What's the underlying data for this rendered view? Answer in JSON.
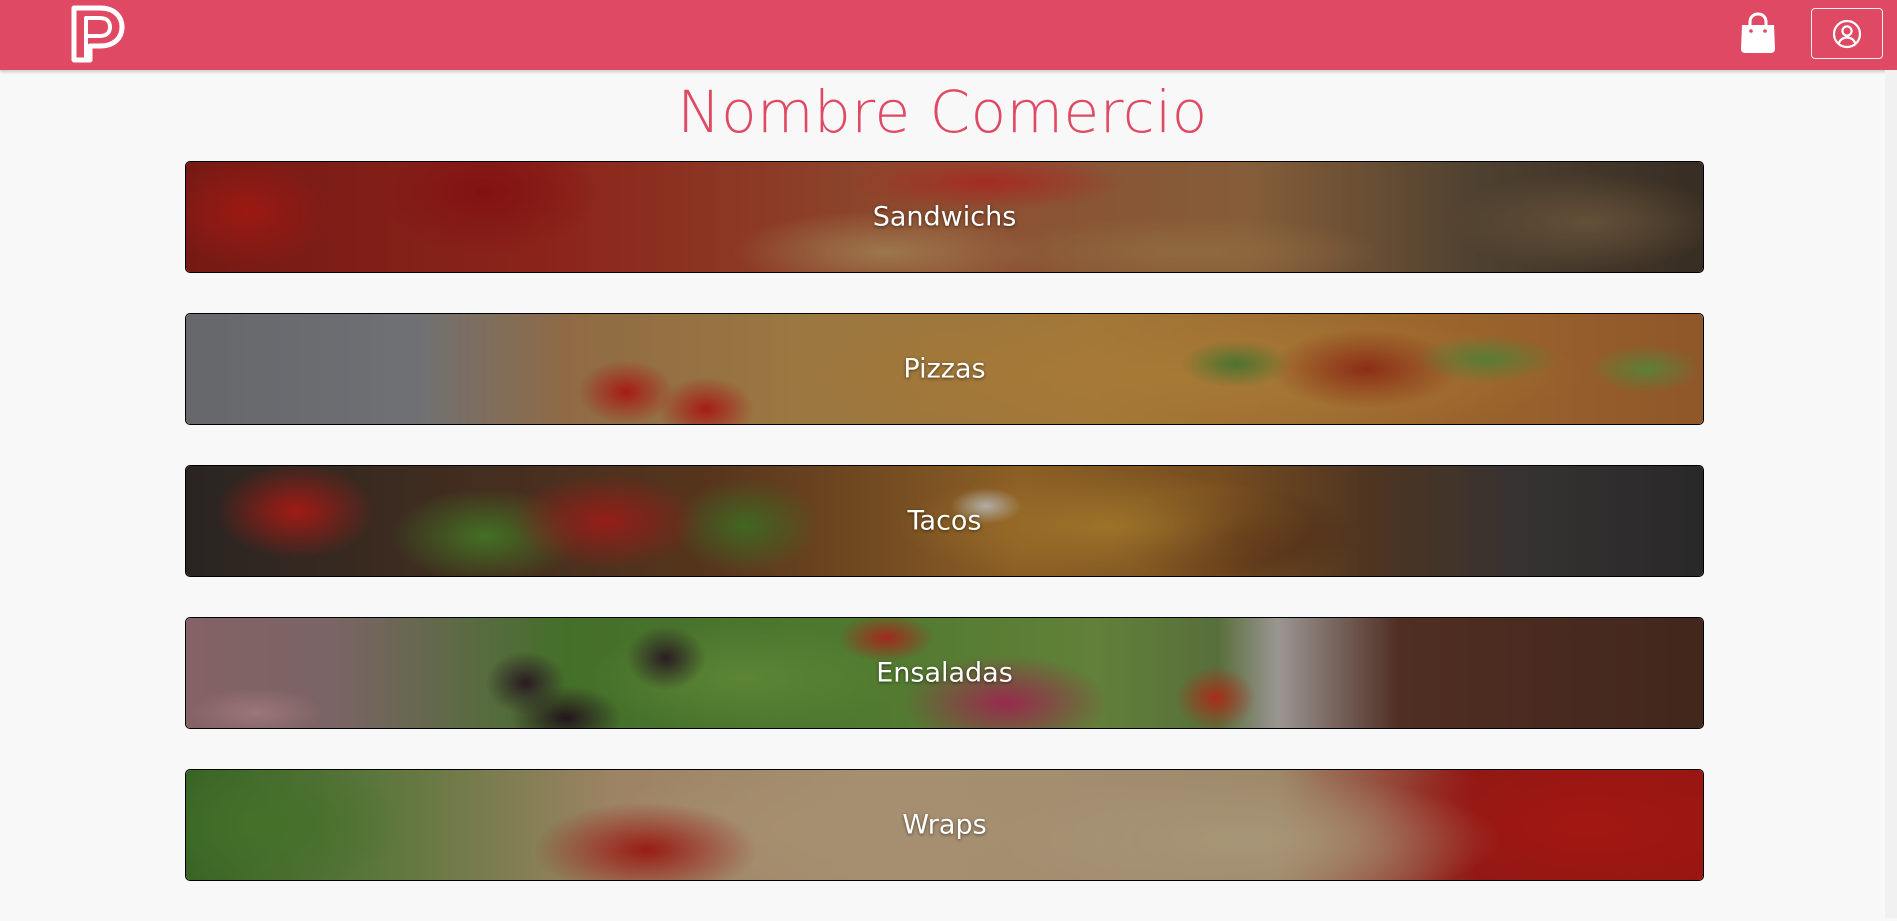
{
  "header": {
    "logo_icon": "brand-p-logo",
    "cart_icon": "shopping-bag-icon",
    "user_icon": "user-circle-icon",
    "color": "#df4963"
  },
  "page": {
    "title": "Nombre Comercio"
  },
  "categories": [
    {
      "label": "Sandwichs"
    },
    {
      "label": "Pizzas"
    },
    {
      "label": "Tacos"
    },
    {
      "label": "Ensaladas"
    },
    {
      "label": "Wraps"
    }
  ]
}
